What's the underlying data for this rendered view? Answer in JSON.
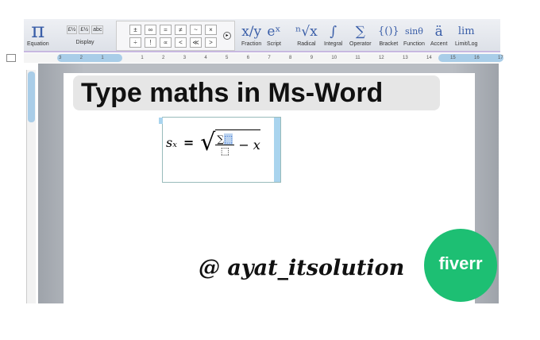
{
  "ribbon": {
    "equation": {
      "glyph": "π",
      "label": "Equation"
    },
    "display": {
      "label": "Display",
      "buttons": [
        "£½",
        "£½",
        "abc"
      ]
    },
    "symbols_row1": [
      "±",
      "∞",
      "=",
      "≠",
      "~",
      "×"
    ],
    "symbols_row2": [
      "÷",
      "!",
      "∝",
      "<",
      "≪",
      ">"
    ],
    "tools": [
      {
        "glyph": "x/y",
        "label": "Fraction"
      },
      {
        "glyph": "eˣ",
        "label": "Script"
      },
      {
        "glyph": "ⁿ√x",
        "label": "Radical"
      },
      {
        "glyph": "∫",
        "label": "Integral"
      },
      {
        "glyph": "∑",
        "label": "Operator"
      },
      {
        "glyph": "{()}",
        "label": "Bracket"
      },
      {
        "glyph": "sinθ",
        "label": "Function"
      },
      {
        "glyph": "ä",
        "label": "Accent"
      },
      {
        "glyph": "lim",
        "label": "Limit/Log"
      }
    ]
  },
  "ruler": {
    "ticks": [
      "3",
      "2",
      "1",
      "",
      "1",
      "2",
      "3",
      "4",
      "5",
      "6",
      "7",
      "8",
      "9",
      "10",
      "11",
      "12",
      "13",
      "14",
      "15",
      "16",
      "17"
    ]
  },
  "document": {
    "title": "Type maths in Ms-Word",
    "equation": {
      "lhs": "sₓ",
      "eq": "=",
      "sum": "∑",
      "placeholder": "⬚",
      "minus": "−",
      "x": "x"
    },
    "watermark": "@ ayat_itsolution",
    "badge": "fiverr"
  },
  "colors": {
    "accent": "#1dbf73",
    "ribbon_blue": "#3a5ea8"
  }
}
